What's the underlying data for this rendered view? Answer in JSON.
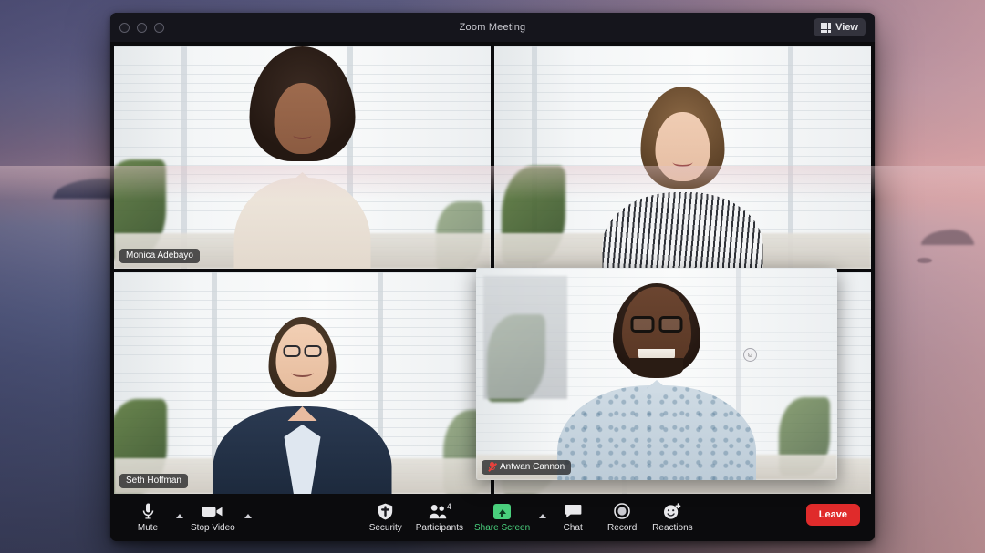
{
  "desktop": {
    "wallpaper_name": "dusk-seascape-wallpaper"
  },
  "window": {
    "title": "Zoom Meeting",
    "traffic_lights": [
      "close",
      "minimize",
      "zoom"
    ],
    "view_button": {
      "label": "View",
      "icon": "grid-icon"
    }
  },
  "participants": [
    {
      "name": "Monica Adebayo",
      "position": "top-left",
      "active_speaker": false,
      "muted": false
    },
    {
      "name": "",
      "position": "top-right",
      "active_speaker": false,
      "muted": false
    },
    {
      "name": "Seth Hoffman",
      "position": "bottom-left",
      "active_speaker": true,
      "muted": false
    },
    {
      "name": "Antwan Cannon",
      "position": "floating-overlay",
      "active_speaker": false,
      "muted": true
    }
  ],
  "toolbar": {
    "mute": {
      "label": "Mute",
      "icon": "microphone-icon",
      "has_caret": true
    },
    "video": {
      "label": "Stop Video",
      "icon": "camera-icon",
      "has_caret": true
    },
    "security": {
      "label": "Security",
      "icon": "shield-icon"
    },
    "participants": {
      "label": "Participants",
      "icon": "people-icon",
      "count": "4"
    },
    "share_screen": {
      "label": "Share Screen",
      "icon": "share-up-arrow-icon",
      "has_caret": true
    },
    "chat": {
      "label": "Chat",
      "icon": "speech-bubble-icon"
    },
    "record": {
      "label": "Record",
      "icon": "record-circle-icon"
    },
    "reactions": {
      "label": "Reactions",
      "icon": "smiley-plus-icon"
    },
    "leave": {
      "label": "Leave"
    }
  },
  "colors": {
    "accent_green": "#4ad07d",
    "active_border": "#0f9d58",
    "leave_red": "#e02b2b",
    "muted_red": "#e8413c",
    "window_bg": "#0b0b0d",
    "titlebar_bg": "#15151c"
  }
}
